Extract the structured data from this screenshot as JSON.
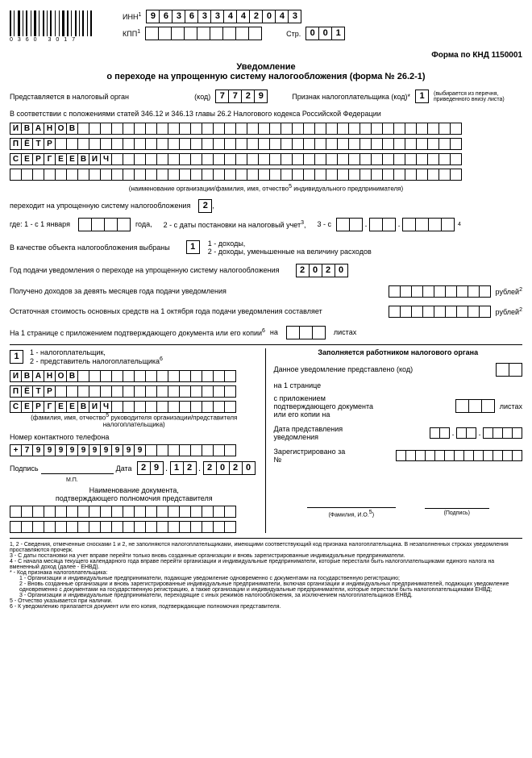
{
  "inn_label": "ИНН",
  "inn": "963633442043",
  "kpp_label": "КПП",
  "kpp": "",
  "page_label": "Стр.",
  "page": "001",
  "form_code": "Форма по КНД 1150001",
  "title1": "Уведомление",
  "title2": "о переходе на упрощенную систему налогообложения (форма № 26.2-1)",
  "submit_to": "Представляется в налоговый орган",
  "code_label": "(код)",
  "tax_code": "7729",
  "sign_label": "Признак налогоплательщика (код)*",
  "sign": "1",
  "sign_note": "(выбирается из перечня, приведенного внизу листа)",
  "law_ref": "В соответствии с положениями статей 346.12 и 346.13 главы 26.2 Налогового кодекса Российской Федерации",
  "name1": "ИВАНОВ",
  "name2": "ПЁТР",
  "name3": "СЕРГЕЕВИЧ",
  "name_caption": "(наименование организации/фамилия, имя, отчество",
  "name_caption2": " индивидуального предпринимателя)",
  "transition": "переходит на упрощенную систему налогообложения",
  "trans_code": "2",
  "where": "где: 1 - с 1 января",
  "year_label": "года,",
  "opt2": "2 - с даты постановки на налоговый учет",
  "opt3": "3 - с",
  "object_label": "В качестве объекта налогообложения выбраны",
  "object_code": "1",
  "object1": "1 - доходы,",
  "object2": "2 - доходы, уменьшенные на величину расходов",
  "year_notice": "Год подачи уведомления о переходе на упрощенную систему налогообложения",
  "year": "2020",
  "income9m": "Получено доходов за девять месяцев года подачи уведомления",
  "rubles": "рублей",
  "residual": "Остаточная стоимость основных средств на 1 октября года подачи уведомления составляет",
  "pages_text": "На 1 странице с приложением подтверждающего документа или его копии",
  "pages_suffix": "на",
  "sheets": "листах",
  "who1": "1 - налогоплательщик,",
  "who2": "2 - представитель налогоплательщика",
  "who_code": "1",
  "rep_name1": "ИВАНОВ",
  "rep_name2": "ПЁТР",
  "rep_name3": "СЕРГЕЕВИЧ",
  "rep_caption": "(фамилия, имя, отчество",
  "rep_caption2": " руководителя организации/представителя налогоплательщика)",
  "phone_label": "Номер контактного телефона",
  "phone": "+79999999999",
  "sig_label": "Подпись",
  "mp": "М.П.",
  "date_label": "Дата",
  "date_d": "29",
  "date_m": "12",
  "date_y": "2020",
  "doc_title": "Наименование документа,",
  "doc_title2": "подтверждающего полномочия представителя",
  "right_title": "Заполняется работником налогового органа",
  "submitted": "Данное уведомление представлено (код)",
  "on_pages": "на 1 странице",
  "with_attach": "с приложением подтверждающего документа или его копии на",
  "date_submit": "Дата представления уведомления",
  "registered": "Зарегистрировано за №",
  "fio_label": "(Фамилия, И.О.",
  "sig_label2": "(Подпись)",
  "fn1": "1, 2 - Сведения, отмеченные сносками 1 и 2, не заполняются налогоплательщиками, имеющими соответствующий код признака налогоплательщика. В незаполненных строках уведомления проставляются прочерк.",
  "fn3": "3 - С даты постановки на учет вправе перейти только вновь созданные организации и вновь зарегистрированные индивидуальные предприниматели.",
  "fn4": "4 - С начала месяца текущего календарного года вправе перейти организации и индивидуальные предприниматели, которые перестали быть налогоплательщиками единого налога на вмененный доход (далее - ЕНВД).",
  "fn_star": "* - Код признака налогоплательщика:",
  "fn_s1": "1 - Организации и индивидуальные предприниматели, подающие уведомление одновременно с документами на государственную регистрацию;",
  "fn_s2": "2 - Вновь созданные организации и вновь зарегистрированные индивидуальные предприниматели, включая организации и индивидуальных предпринимателей, подающих уведомление одновременно с документами на государственную регистрацию, а также организации и индивидуальные предприниматели, которые перестали быть налогоплательщиками ЕНВД;",
  "fn_s3": "3 - Организации и индивидуальные предприниматели, переходящие с иных режимов налогообложения, за исключением налогоплательщиков ЕНВД.",
  "fn5": "5 - Отчество указывается при наличии.",
  "fn6": "6 - К уведомлению прилагается документ или его копия, подтверждающие полномочия представителя.",
  "barcode_num": "0360 3017"
}
